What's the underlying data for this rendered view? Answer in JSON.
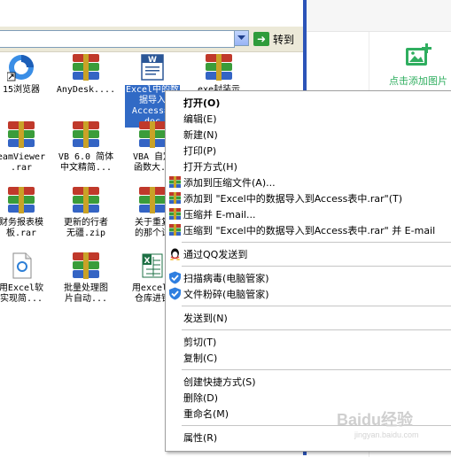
{
  "addressbar": {
    "go_label": "转到"
  },
  "right_panel": {
    "add_photo_label": "点击添加图片"
  },
  "files": [
    {
      "label": "15浏览器",
      "icon": "browser-icon"
    },
    {
      "label": "AnyDesk....",
      "icon": "winrar-archive-icon"
    },
    {
      "label": "Excel中的数\n据导入\nAccess表\ndoc",
      "icon": "word-document-icon",
      "selected": true
    },
    {
      "label": "exe封装示",
      "icon": "winrar-archive-icon"
    },
    {
      "label": "eamViewer\n.rar",
      "icon": "winrar-archive-icon"
    },
    {
      "label": "VB 6.0 简体\n中文精简...",
      "icon": "winrar-archive-icon"
    },
    {
      "label": "VBA 自定\n函数大..",
      "icon": "winrar-archive-icon"
    },
    {
      "label": "财务报表模\n板.rar",
      "icon": "winrar-archive-icon"
    },
    {
      "label": "更新的行者\n无疆.zip",
      "icon": "winrar-archive-icon"
    },
    {
      "label": "关于重复\n的那个试",
      "icon": "winrar-archive-icon"
    },
    {
      "label": "用Excel软\n实现简...",
      "icon": "document-icon"
    },
    {
      "label": "批量处理图\n片自动...",
      "icon": "winrar-archive-icon"
    },
    {
      "label": "用excel(\n仓库进销",
      "icon": "excel-icon"
    }
  ],
  "context_menu": {
    "items": [
      {
        "label": "打开(O)",
        "bold": true
      },
      {
        "label": "编辑(E)"
      },
      {
        "label": "新建(N)"
      },
      {
        "label": "打印(P)"
      },
      {
        "label": "打开方式(H)"
      },
      {
        "label": "添加到压缩文件(A)...",
        "icon": "winrar-icon"
      },
      {
        "label": "添加到 \"Excel中的数据导入到Access表中.rar\"(T)",
        "icon": "winrar-icon"
      },
      {
        "label": "压缩并 E-mail...",
        "icon": "winrar-icon"
      },
      {
        "label": "压缩到 \"Excel中的数据导入到Access表中.rar\" 并 E-mail",
        "icon": "winrar-icon"
      },
      {
        "label": "通过QQ发送到",
        "icon": "qq-icon"
      },
      {
        "label": "扫描病毒(电脑管家)",
        "icon": "shield-icon"
      },
      {
        "label": "文件粉碎(电脑管家)",
        "icon": "shield-icon"
      },
      {
        "label": "发送到(N)"
      },
      {
        "label": "剪切(T)"
      },
      {
        "label": "复制(C)"
      },
      {
        "label": "创建快捷方式(S)"
      },
      {
        "label": "删除(D)"
      },
      {
        "label": "重命名(M)"
      },
      {
        "label": "属性(R)"
      }
    ]
  },
  "colors": {
    "selection": "#316ac5",
    "taskbar_blue": "#2c54b8",
    "accent_green": "#2fae5f"
  },
  "watermark": {
    "text": "Baidu经验",
    "sub": "jingyan.baidu.com"
  }
}
